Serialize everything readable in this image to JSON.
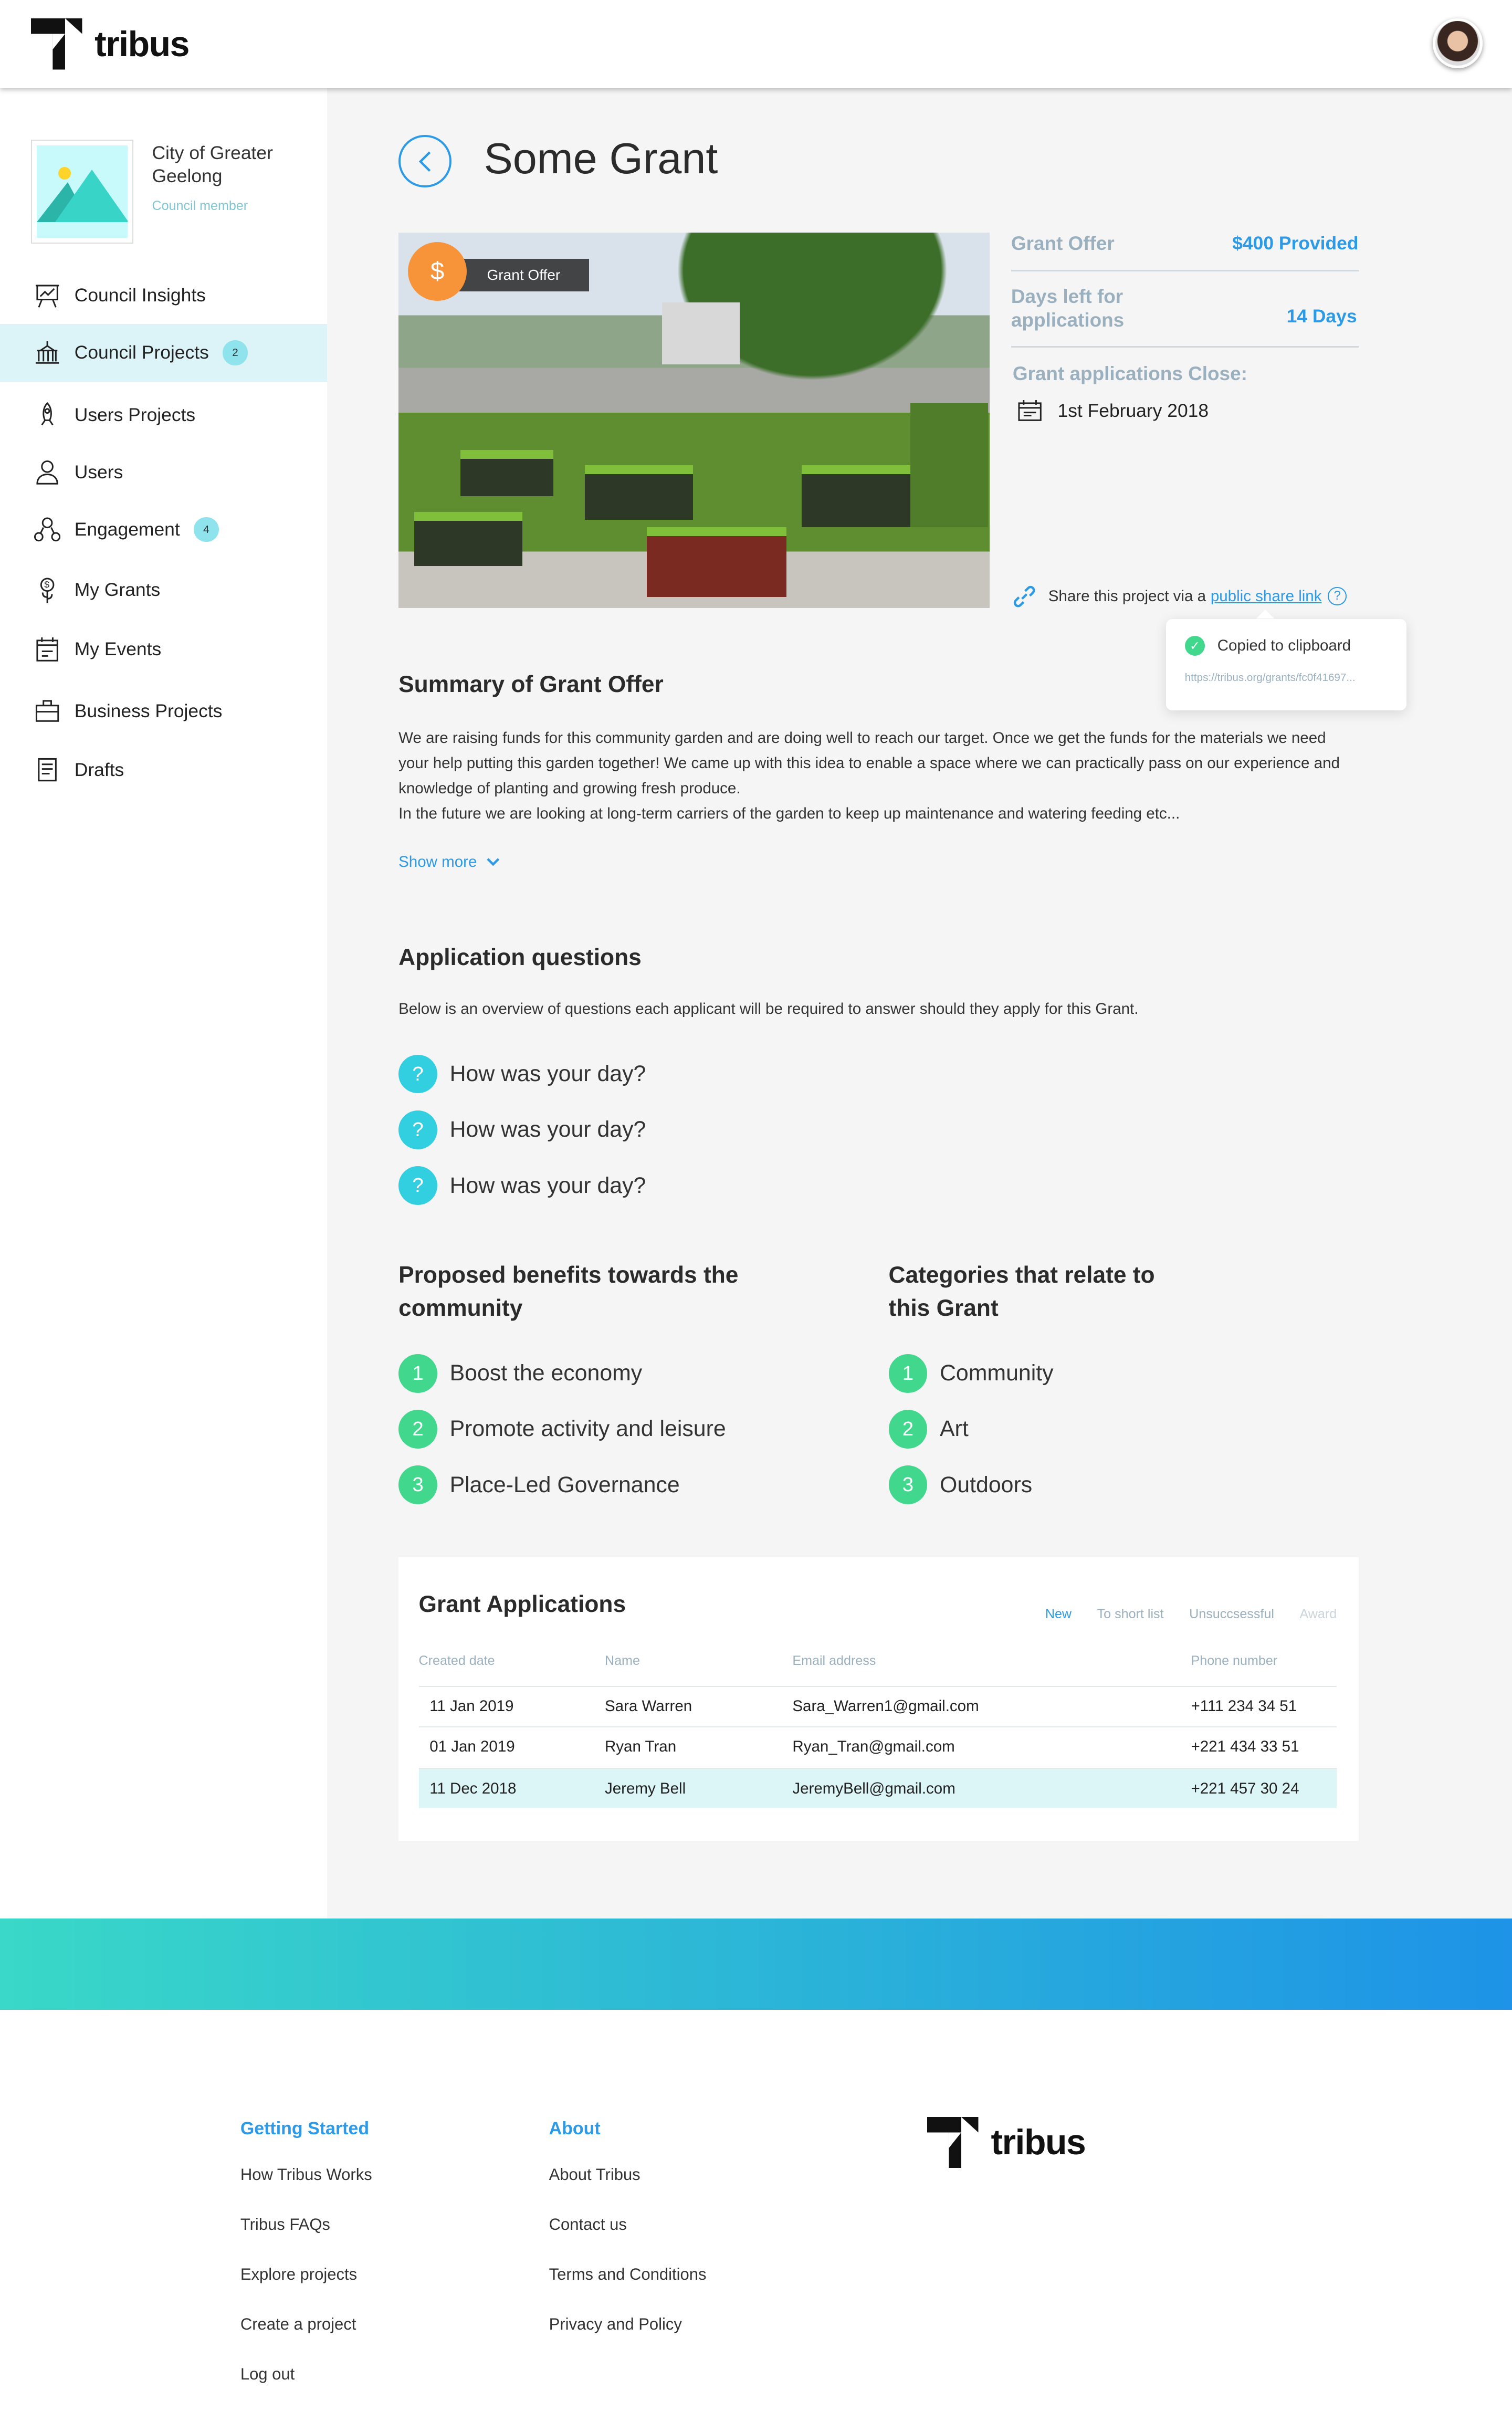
{
  "brand": {
    "name": "tribus"
  },
  "colors": {
    "accent": "#2c9ae6",
    "active_nav": "#dcf4f7",
    "question": "#32cfe0",
    "number": "#41d88e",
    "grant_icon": "#f7943a"
  },
  "sidebar": {
    "org_name": "City of Greater Geelong",
    "org_role": "Council member",
    "items": [
      {
        "label": "Council Insights",
        "icon": "presentation-chart-icon"
      },
      {
        "label": "Council Projects",
        "icon": "government-building-icon",
        "badge": "2",
        "active": true
      },
      {
        "label": "Users Projects",
        "icon": "rocket-icon"
      },
      {
        "label": "Users",
        "icon": "user-icon"
      },
      {
        "label": "Engagement",
        "icon": "engagement-icon",
        "badge": "4"
      },
      {
        "label": "My Grants",
        "icon": "money-plant-icon"
      },
      {
        "label": "My Events",
        "icon": "calendar-icon"
      },
      {
        "label": "Business Projects",
        "icon": "briefcase-icon"
      },
      {
        "label": "Drafts",
        "icon": "document-icon"
      }
    ]
  },
  "page": {
    "title": "Some Grant",
    "image_badge": "Grant Offer"
  },
  "info": {
    "grant_offer_label": "Grant Offer",
    "grant_offer_value": "$400 Provided",
    "days_left_label": "Days left for applications",
    "days_left_value": "14 Days",
    "close_label": "Grant applications Close:",
    "close_date": "1st February 2018",
    "share_text": "Share this project via a",
    "share_link": "public share link"
  },
  "tooltip": {
    "title": "Copied to clipboard",
    "url": "https://tribus.org/grants/fc0f41697..."
  },
  "summary": {
    "heading": "Summary of Grant Offer",
    "p1": "We are raising funds for this community garden and are doing well to reach our target. Once we get the funds for the materials we need your help putting this garden together! We came up with this idea to enable a space where we can practically pass on our experience and knowledge of planting and growing fresh produce.",
    "p2": "In the future we are looking at long-term carriers of the garden to keep up maintenance and watering feeding etc...",
    "show_more": "Show more"
  },
  "questions": {
    "heading": "Application questions",
    "description": "Below is an overview of questions each applicant will be required to answer should they apply for this Grant.",
    "items": [
      "How was your day?",
      "How was your day?",
      "How was your day?"
    ]
  },
  "benefits": {
    "heading": "Proposed benefits towards the community",
    "items": [
      "Boost the economy",
      "Promote activity and leisure",
      "Place-Led Governance"
    ]
  },
  "categories": {
    "heading": "Categories that relate to this Grant",
    "items": [
      "Community",
      "Art",
      "Outdoors"
    ]
  },
  "applications": {
    "heading": "Grant Applications",
    "tabs": [
      "New",
      "To short list",
      "Unsuccsessful",
      "Award"
    ],
    "columns": [
      "Created date",
      "Name",
      "Email address",
      "Phone number"
    ],
    "rows": [
      [
        "11 Jan 2019",
        "Sara Warren",
        "Sara_Warren1@gmail.com",
        "+111 234 34 51"
      ],
      [
        "01 Jan 2019",
        "Ryan Tran",
        "Ryan_Tran@gmail.com",
        "+221 434 33 51"
      ],
      [
        "11 Dec 2018",
        "Jeremy Bell",
        "JeremyBell@gmail.com",
        "+221 457 30 24"
      ]
    ]
  },
  "footer": {
    "col1": {
      "heading": "Getting Started",
      "links": [
        "How Tribus Works",
        "Tribus FAQs",
        "Explore projects",
        "Create a project",
        "Log out"
      ]
    },
    "col2": {
      "heading": "About",
      "links": [
        "About Tribus",
        "Contact us",
        "Terms and Conditions",
        "Privacy and Policy"
      ]
    }
  }
}
